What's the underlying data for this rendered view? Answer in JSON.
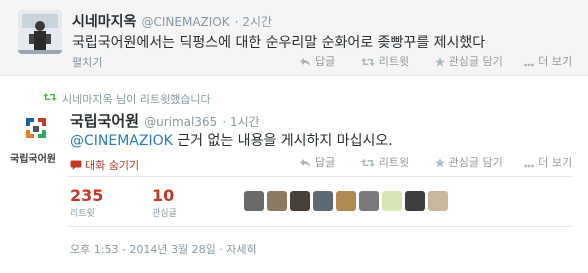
{
  "tweet1": {
    "name": "시네마지옥",
    "handle": "@CINEMAZIOK",
    "time": "· 2시간",
    "text": "국립국어원에서는 딕펑스에 대한 순우리말 순화어로 좆빵꾸를 제시했다",
    "expand": "펼치기",
    "actions": {
      "reply": "답글",
      "retweet": "리트윗",
      "favorite": "관심글 담기",
      "more": "더 보기"
    }
  },
  "tweet2": {
    "retweeted_by": "시네마지옥 님이 리트윗했습니다",
    "name": "국립국어원",
    "handle": "@urimal365",
    "time": "· 1시간",
    "mention": "@CINEMAZIOK",
    "text": " 근거 없는 내용을 게시하지 마십시오.",
    "avatar_caption": "국립국어원",
    "hide_conversation": "대화 숨기기",
    "actions": {
      "reply": "답글",
      "retweet": "리트윗",
      "favorite": "관심글 담기",
      "more": "더 보기"
    },
    "stats": {
      "retweets": "235",
      "retweets_label": "리트윗",
      "favorites": "10",
      "favorites_label": "관심글"
    },
    "timestamp": "오후 1:53 - 2014년 3월 28일 · 자세히"
  },
  "colors": {
    "link": "#2b7bb9",
    "stat": "#c0392b",
    "muted": "#8899a6"
  }
}
